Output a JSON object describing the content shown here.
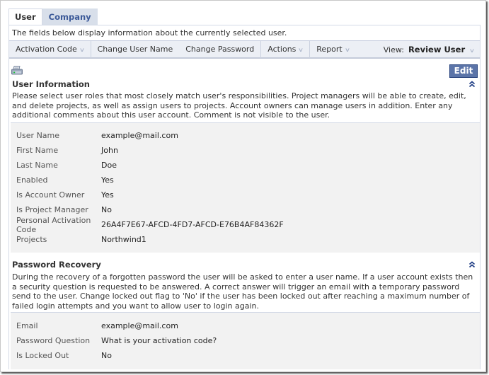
{
  "tabs": [
    {
      "label": "User",
      "active": true
    },
    {
      "label": "Company",
      "active": false
    }
  ],
  "description": "The fields below display information about the currently selected user.",
  "toolbar": {
    "items": [
      {
        "label": "Activation Code",
        "has_dropdown": true
      },
      {
        "label": "Change User Name",
        "has_dropdown": false
      },
      {
        "label": "Change Password",
        "has_dropdown": false
      },
      {
        "label": "Actions",
        "has_dropdown": true
      },
      {
        "label": "Report",
        "has_dropdown": true
      }
    ],
    "view_label": "View:",
    "view_value": "Review User"
  },
  "icons": {
    "print": "printer-icon",
    "collapse": "double-chevron-up-icon",
    "dropdown": "chevron-down-icon"
  },
  "edit_label": "Edit",
  "user_info": {
    "title": "User Information",
    "description": "Please select user roles that most closely match user's responsibilities. Project managers will be able to create, edit, and delete projects, as well as assign users to projects. Account owners can manage users in addition. Enter any additional comments about this user account. Comment is not visible to the user.",
    "fields": [
      {
        "label": "User Name",
        "value": "example@mail.com"
      },
      {
        "label": "First Name",
        "value": "John"
      },
      {
        "label": "Last Name",
        "value": "Doe"
      },
      {
        "label": "Enabled",
        "value": "Yes"
      },
      {
        "label": "Is Account Owner",
        "value": "Yes"
      },
      {
        "label": "Is Project Manager",
        "value": "No"
      },
      {
        "label": "Personal Activation Code",
        "value": "26A4F7E67-AFCD-4FD7-AFCD-E76B4AF84362F"
      },
      {
        "label": "Projects",
        "value": "Northwind1"
      }
    ]
  },
  "password_recovery": {
    "title": "Password Recovery",
    "description": "During the recovery of a forgotten password the user will be asked to enter a user name. If a user account exists then a security question is requested to be answered. A correct answer will trigger an email with a temporary password send to the user. Change locked out flag to 'No' if the user has been locked out after reaching a maximum number of failed login attempts and you want to allow user to login again.",
    "fields": [
      {
        "label": "Email",
        "value": "example@mail.com"
      },
      {
        "label": "Password Question",
        "value": "What is your activation code?"
      },
      {
        "label": "Is Locked Out",
        "value": "No"
      }
    ]
  },
  "colors": {
    "accent": "#3b5998",
    "button_bg": "#5b74a8",
    "toolbar_bg": "#eceff5",
    "field_bg": "#f2f2f2"
  }
}
